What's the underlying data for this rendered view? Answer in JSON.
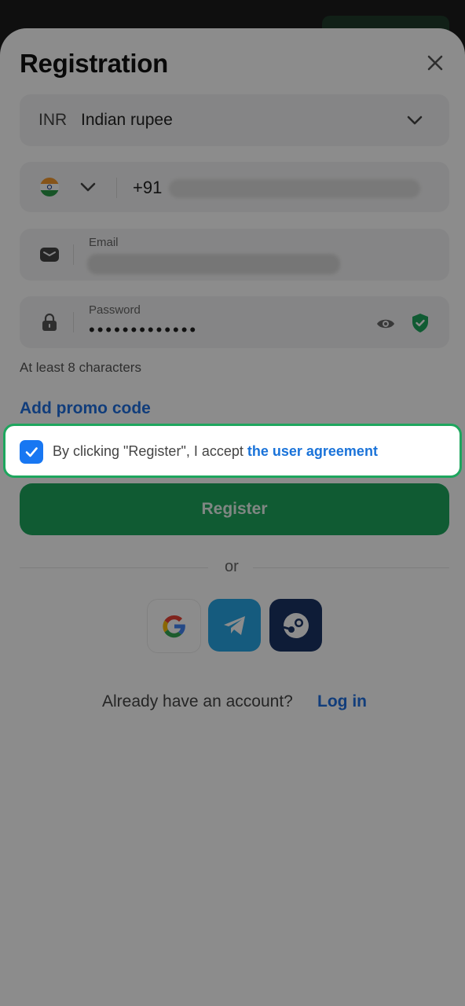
{
  "header": {
    "title": "Registration"
  },
  "currency": {
    "code": "INR",
    "name": "Indian rupee"
  },
  "phone": {
    "country_code": "+91"
  },
  "email": {
    "label": "Email"
  },
  "password": {
    "label": "Password",
    "masked_value": "•••••••••••••",
    "hint": "At least 8 characters"
  },
  "promo": {
    "link_label": "Add promo code"
  },
  "agreement": {
    "checked": true,
    "text": "By clicking \"Register\", I accept ",
    "link_label": "the user agreement"
  },
  "register": {
    "label": "Register"
  },
  "divider": {
    "label": "or"
  },
  "social": [
    "google-icon",
    "telegram-icon",
    "steam-icon"
  ],
  "footer": {
    "question": "Already have an account?",
    "login_label": "Log in"
  },
  "colors": {
    "primary_green": "#1ea65e",
    "link_blue": "#1f6fe0",
    "checkbox_blue": "#1877f2"
  }
}
